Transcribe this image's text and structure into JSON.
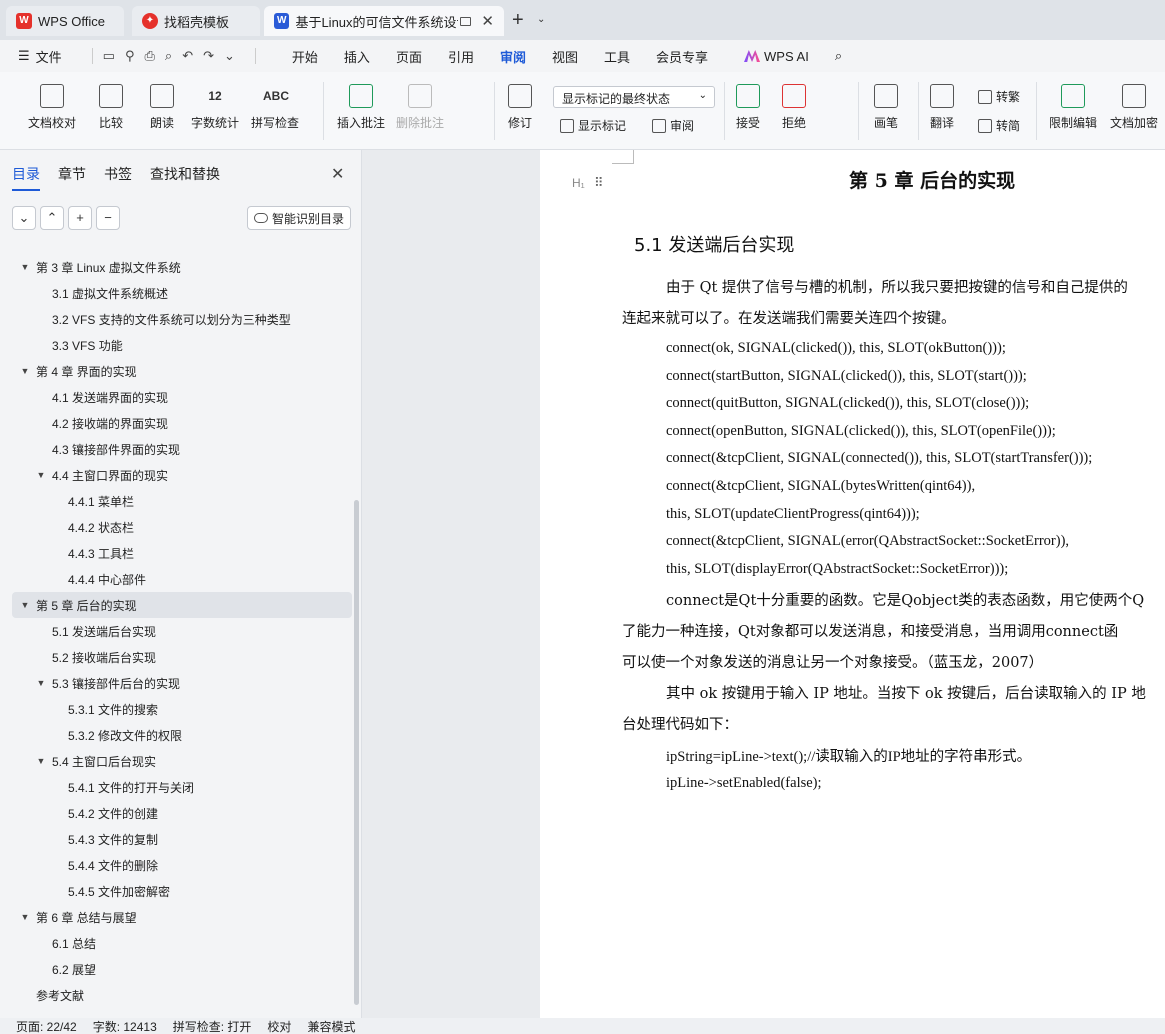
{
  "tabs": {
    "wps": "WPS Office",
    "template": "找稻壳模板",
    "document": "基于Linux的可信文件系统设计",
    "new_tab": "+"
  },
  "menu": {
    "file": "文件",
    "items": [
      "开始",
      "插入",
      "页面",
      "引用",
      "审阅",
      "视图",
      "工具",
      "会员专享"
    ],
    "active": "审阅",
    "ai": "WPS AI"
  },
  "ribbon": {
    "proofread": "文档校对",
    "compare": "比较",
    "read_aloud": "朗读",
    "word_count": "字数统计",
    "word_count_icon": "12",
    "spellcheck": "拼写检查",
    "spellcheck_icon": "ABC",
    "insert_comment": "插入批注",
    "delete_comment": "删除批注",
    "revise": "修订",
    "show_markup_select": "显示标记的最终状态",
    "show_markup": "显示标记",
    "review": "审阅",
    "accept": "接受",
    "reject": "拒绝",
    "pen": "画笔",
    "translate": "翻译",
    "to_traditional": "转繁",
    "to_simplified": "转简",
    "restrict_edit": "限制编辑",
    "encrypt": "文档加密"
  },
  "nav": {
    "tabs": [
      "目录",
      "章节",
      "书签",
      "查找和替换"
    ],
    "active_tab": "目录",
    "smart_toc": "智能识别目录",
    "toc": [
      {
        "level": 1,
        "text": "第 3 章  Linux 虚拟文件系统",
        "arrow": "▼"
      },
      {
        "level": 2,
        "text": "3.1 虚拟文件系统概述",
        "arrow": ""
      },
      {
        "level": 2,
        "text": "3.2  VFS 支持的文件系统可以划分为三种类型",
        "arrow": ""
      },
      {
        "level": 2,
        "text": "3.3 VFS 功能",
        "arrow": ""
      },
      {
        "level": 1,
        "text": "第 4 章 界面的实现",
        "arrow": "▼"
      },
      {
        "level": 2,
        "text": "4.1 发送端界面的实现",
        "arrow": ""
      },
      {
        "level": 2,
        "text": "4.2 接收端的界面实现",
        "arrow": ""
      },
      {
        "level": 2,
        "text": "4.3 镶接部件界面的实现",
        "arrow": ""
      },
      {
        "level": 2,
        "text": "4.4 主窗口界面的现实",
        "arrow": "▼"
      },
      {
        "level": 3,
        "text": "4.4.1 菜单栏",
        "arrow": ""
      },
      {
        "level": 3,
        "text": "4.4.2 状态栏",
        "arrow": ""
      },
      {
        "level": 3,
        "text": "4.4.3 工具栏",
        "arrow": ""
      },
      {
        "level": 3,
        "text": "4.4.4 中心部件",
        "arrow": ""
      },
      {
        "level": 1,
        "text": "第 5 章 后台的实现",
        "arrow": "▼",
        "selected": true
      },
      {
        "level": 2,
        "text": "5.1 发送端后台实现",
        "arrow": ""
      },
      {
        "level": 2,
        "text": "5.2 接收端后台实现",
        "arrow": ""
      },
      {
        "level": 2,
        "text": "5.3 镶接部件后台的实现",
        "arrow": "▼"
      },
      {
        "level": 3,
        "text": "5.3.1 文件的搜索",
        "arrow": ""
      },
      {
        "level": 3,
        "text": "5.3.2 修改文件的权限",
        "arrow": ""
      },
      {
        "level": 2,
        "text": "5.4 主窗口后台现实",
        "arrow": "▼"
      },
      {
        "level": 3,
        "text": "5.4.1 文件的打开与关闭",
        "arrow": ""
      },
      {
        "level": 3,
        "text": "5.4.2 文件的创建",
        "arrow": ""
      },
      {
        "level": 3,
        "text": "5.4.3 文件的复制",
        "arrow": ""
      },
      {
        "level": 3,
        "text": "5.4.4 文件的删除",
        "arrow": ""
      },
      {
        "level": 3,
        "text": "5.4.5 文件加密解密",
        "arrow": ""
      },
      {
        "level": 1,
        "text": "第 6 章 总结与展望",
        "arrow": "▼"
      },
      {
        "level": 2,
        "text": "6.1 总结",
        "arrow": ""
      },
      {
        "level": 2,
        "text": "6.2 展望",
        "arrow": ""
      },
      {
        "level": 1,
        "text": "参考文献",
        "arrow": ""
      }
    ]
  },
  "document": {
    "heading_mark": "H₁",
    "chapter_title": "第 5 章 后台的实现",
    "section_title": "5.1 发送端后台实现",
    "p1_line1": "由于 Qt 提供了信号与槽的机制，所以我只要把按键的信号和自己提供的",
    "p1_line2": "连起来就可以了。在发送端我们需要关连四个按键。",
    "code_lines": [
      "connect(ok, SIGNAL(clicked()), this, SLOT(okButton()));",
      "connect(startButton, SIGNAL(clicked()), this, SLOT(start()));",
      "connect(quitButton, SIGNAL(clicked()), this, SLOT(close()));",
      "connect(openButton, SIGNAL(clicked()), this, SLOT(openFile()));",
      "connect(&tcpClient, SIGNAL(connected()), this, SLOT(startTransfer()));",
      "connect(&tcpClient, SIGNAL(bytesWritten(qint64)),",
      "this, SLOT(updateClientProgress(qint64)));",
      "connect(&tcpClient, SIGNAL(error(QAbstractSocket::SocketError)),",
      "this, SLOT(displayError(QAbstractSocket::SocketError)));"
    ],
    "p2_line1": "connect是Qt十分重要的函数。它是Qobject类的表态函数，用它使两个Q",
    "p2_line2": "了能力一种连接，Qt对象都可以发送消息，和接受消息，当用调用connect函",
    "p2_line3": "可以使一个对象发送的消息让另一个对象接受。（蓝玉龙，2007）",
    "p3_line1": "其中 ok 按键用于输入 IP 地址。当按下 ok 按键后，后台读取输入的 IP 地",
    "p3_line2": "台处理代码如下：",
    "code2_line1": "ipString=ipLine->text();//读取输入的IP地址的字符串形式。",
    "code2_line2": "ipLine->setEnabled(false);"
  },
  "status": {
    "page": "页面: 22/42",
    "words": "字数: 12413",
    "spellcheck": "拼写检查: 打开",
    "proof": "校对",
    "compat": "兼容模式"
  }
}
